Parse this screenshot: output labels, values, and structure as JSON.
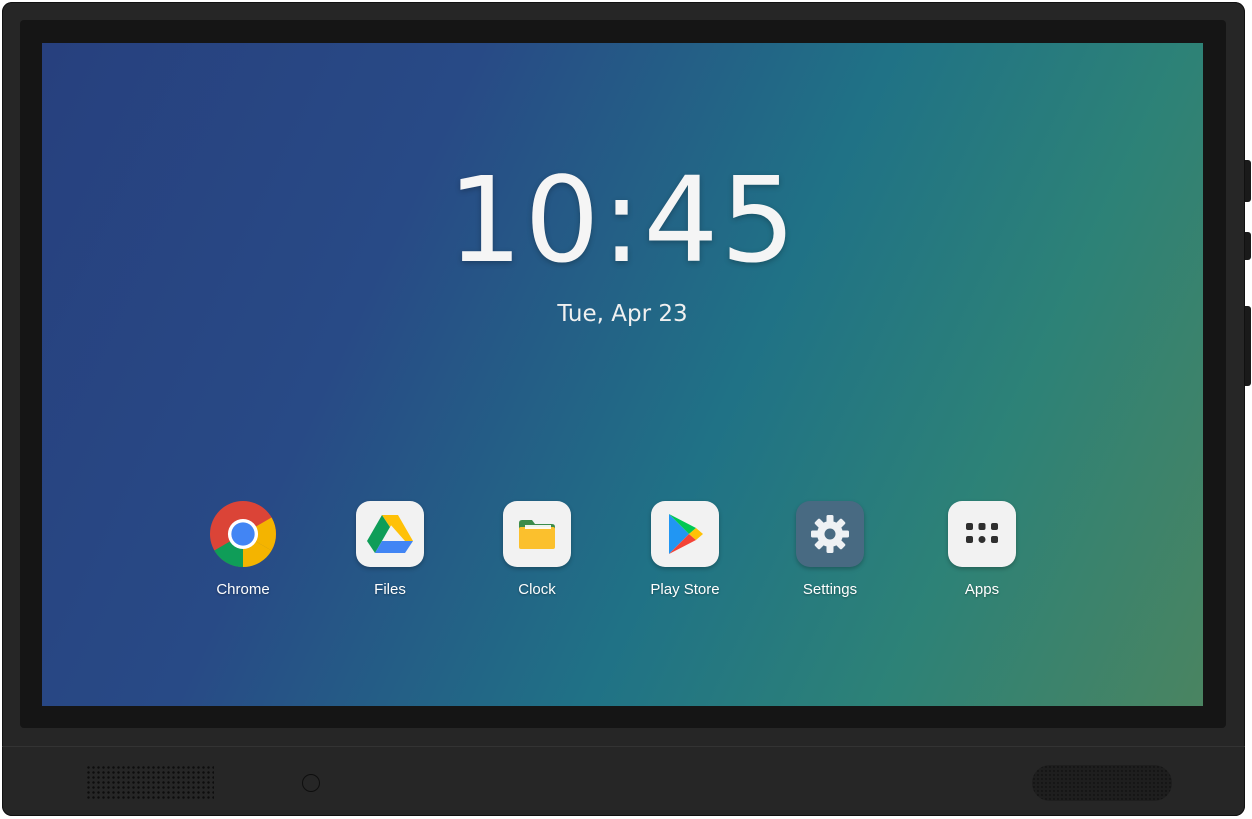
{
  "lockscreen": {
    "time": "10:45",
    "date": "Tue, Apr 23"
  },
  "dock": {
    "apps": [
      {
        "label": "Chrome",
        "icon": "chrome-icon"
      },
      {
        "label": "Files",
        "icon": "drive-icon"
      },
      {
        "label": "Clock",
        "icon": "folder-icon"
      },
      {
        "label": "Play Store",
        "icon": "play-store-icon"
      },
      {
        "label": "Settings",
        "icon": "gear-icon"
      },
      {
        "label": "Apps",
        "icon": "app-grid-icon"
      }
    ]
  },
  "colors": {
    "wallpaper_start": "#27407e",
    "wallpaper_end": "#4a8461",
    "device_frame": "#262626",
    "settings_tile": "#486a82"
  }
}
